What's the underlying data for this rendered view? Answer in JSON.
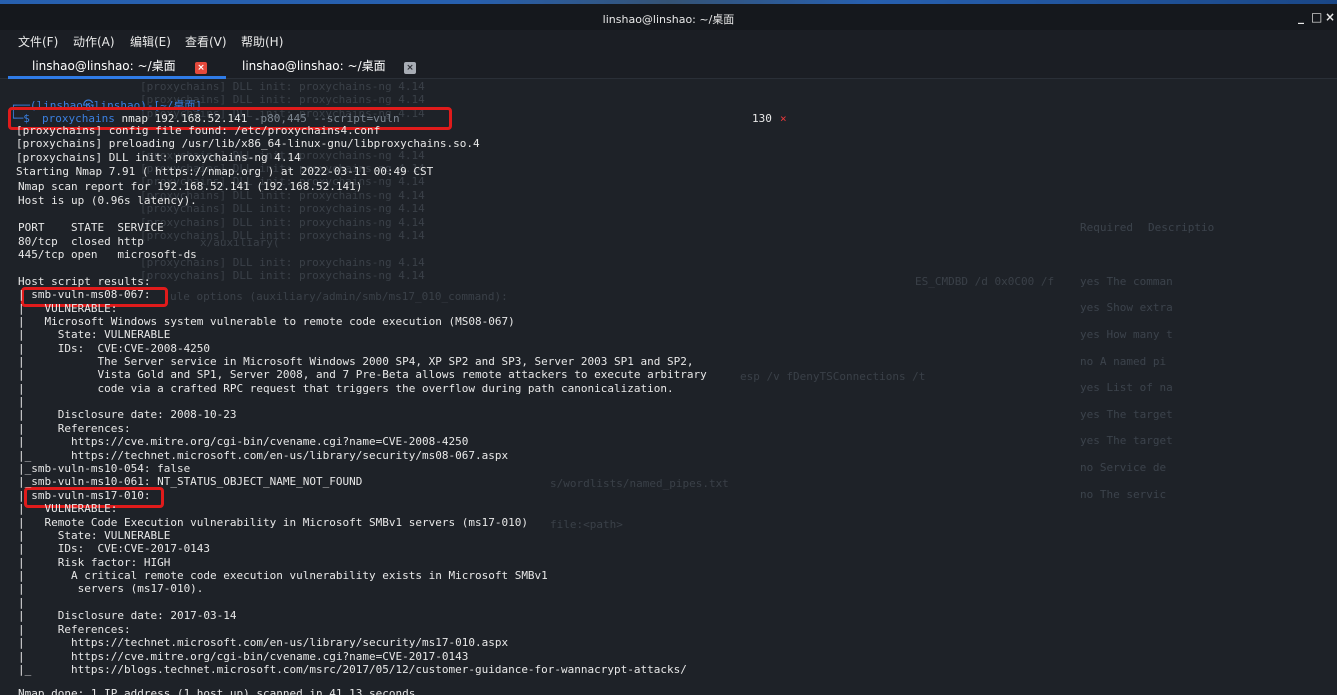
{
  "window": {
    "title": "linshao@linshao: ~/桌面",
    "controls": [
      "_",
      "□",
      "×"
    ]
  },
  "menu": [
    "文件(F)",
    "动作(A)",
    "编辑(E)",
    "查看(V)",
    "帮助(H)"
  ],
  "tabs": [
    {
      "label": "linshao@linshao: ~/桌面",
      "active": true
    },
    {
      "label": "linshao@linshao: ~/桌面",
      "active": false
    }
  ],
  "prompt": {
    "header": "┌──(linshao㉿linshao)-[~/桌面]",
    "corner": "└─$",
    "cmd_name": "proxychains",
    "cmd_nmap": " nmap 192.168.52.141",
    "cmd_opts": " -p80,445 --script=vuln",
    "exit_code": "130",
    "exit_mark": "×"
  },
  "output": [
    "[proxychains] config file found: /etc/proxychains4.conf",
    "[proxychains] preloading /usr/lib/x86_64-linux-gnu/libproxychains.so.4",
    "[proxychains] DLL init: proxychains-ng 4.14",
    "Starting Nmap 7.91 ( https://nmap.org ) at 2022-03-11 00:49 CST",
    "Nmap scan report for 192.168.52.141 (192.168.52.141)",
    "Host is up (0.96s latency).",
    "",
    "PORT    STATE  SERVICE",
    "80/tcp  closed http",
    "445/tcp open   microsoft-ds",
    "",
    "Host script results:",
    "| smb-vuln-ms08-067:",
    "|   VULNERABLE:",
    "|   Microsoft Windows system vulnerable to remote code execution (MS08-067)",
    "|     State: VULNERABLE",
    "|     IDs:  CVE:CVE-2008-4250",
    "|           The Server service in Microsoft Windows 2000 SP4, XP SP2 and SP3, Server 2003 SP1 and SP2,",
    "|           Vista Gold and SP1, Server 2008, and 7 Pre-Beta allows remote attackers to execute arbitrary",
    "|           code via a crafted RPC request that triggers the overflow during path canonicalization.",
    "|",
    "|     Disclosure date: 2008-10-23",
    "|     References:",
    "|       https://cve.mitre.org/cgi-bin/cvename.cgi?name=CVE-2008-4250",
    "|_      https://technet.microsoft.com/en-us/library/security/ms08-067.aspx",
    "|_smb-vuln-ms10-054: false",
    "|_smb-vuln-ms10-061: NT_STATUS_OBJECT_NAME_NOT_FOUND",
    "| smb-vuln-ms17-010:",
    "|   VULNERABLE:",
    "|   Remote Code Execution vulnerability in Microsoft SMBv1 servers (ms17-010)",
    "|     State: VULNERABLE",
    "|     IDs:  CVE:CVE-2017-0143",
    "|     Risk factor: HIGH",
    "|       A critical remote code execution vulnerability exists in Microsoft SMBv1",
    "|        servers (ms17-010).",
    "|",
    "|     Disclosure date: 2017-03-14",
    "|     References:",
    "|       https://technet.microsoft.com/en-us/library/security/ms17-010.aspx",
    "|       https://cve.mitre.org/cgi-bin/cvename.cgi?name=CVE-2017-0143",
    "|_      https://blogs.technet.microsoft.com/msrc/2017/05/12/customer-guidance-for-wannacrypt-attacks/",
    "",
    "Nmap done: 1 IP address (1 host up) scanned in 41.13 seconds"
  ],
  "background_ghost": {
    "right_header": [
      "Required",
      "Descriptio"
    ],
    "right_rows": [
      "yes      The comman",
      "yes      Show extra",
      "yes      How many t",
      "no       A named pi",
      "yes      List of na",
      "yes      The target",
      "yes      The target",
      "no       Service de",
      "no       The servic"
    ],
    "mid_lines": [
      "[proxychains] DLL init: proxychains-ng 4.14",
      "[proxychains] DLL init: proxychains-ng 4.14",
      "[proxychains] DLL init: proxychains-ng 4.14",
      "[proxychains] DLL init: proxychains-ng 4.14",
      "[proxychains] DLL init: proxychains-ng 4.14",
      "[proxychains] DLL init: proxychains-ng 4.14",
      "[proxychains] DLL init: proxychains-ng 4.14",
      "[proxychains] DLL init: proxychains-ng 4.14",
      "[proxychains] DLL init: proxychains-ng 4.14",
      "[proxychains] DLL init: proxychains-ng 4.14",
      "[proxychains] DLL init: proxychains-ng 4.14",
      "[proxychains] DLL init: proxychains-ng 4.14",
      "[proxychains] DLL init: proxychains-ng 4.14"
    ],
    "fragments": [
      "ule options (auxiliary/admin/smb/ms17_010_command):",
      "ES_CMDBD /d 0x0C00 /f",
      "esp /v fDenyTSConnections /t",
      "s/wordlists/named_pipes.txt",
      "file:<path>",
      "x/auxiliary(",
      ") > options"
    ]
  },
  "colors": {
    "prompt_blue": "#3b7fe0",
    "highlight_red": "#e01b1b",
    "terminal_bg": "#1e2228",
    "text": "#e8e8e8"
  }
}
